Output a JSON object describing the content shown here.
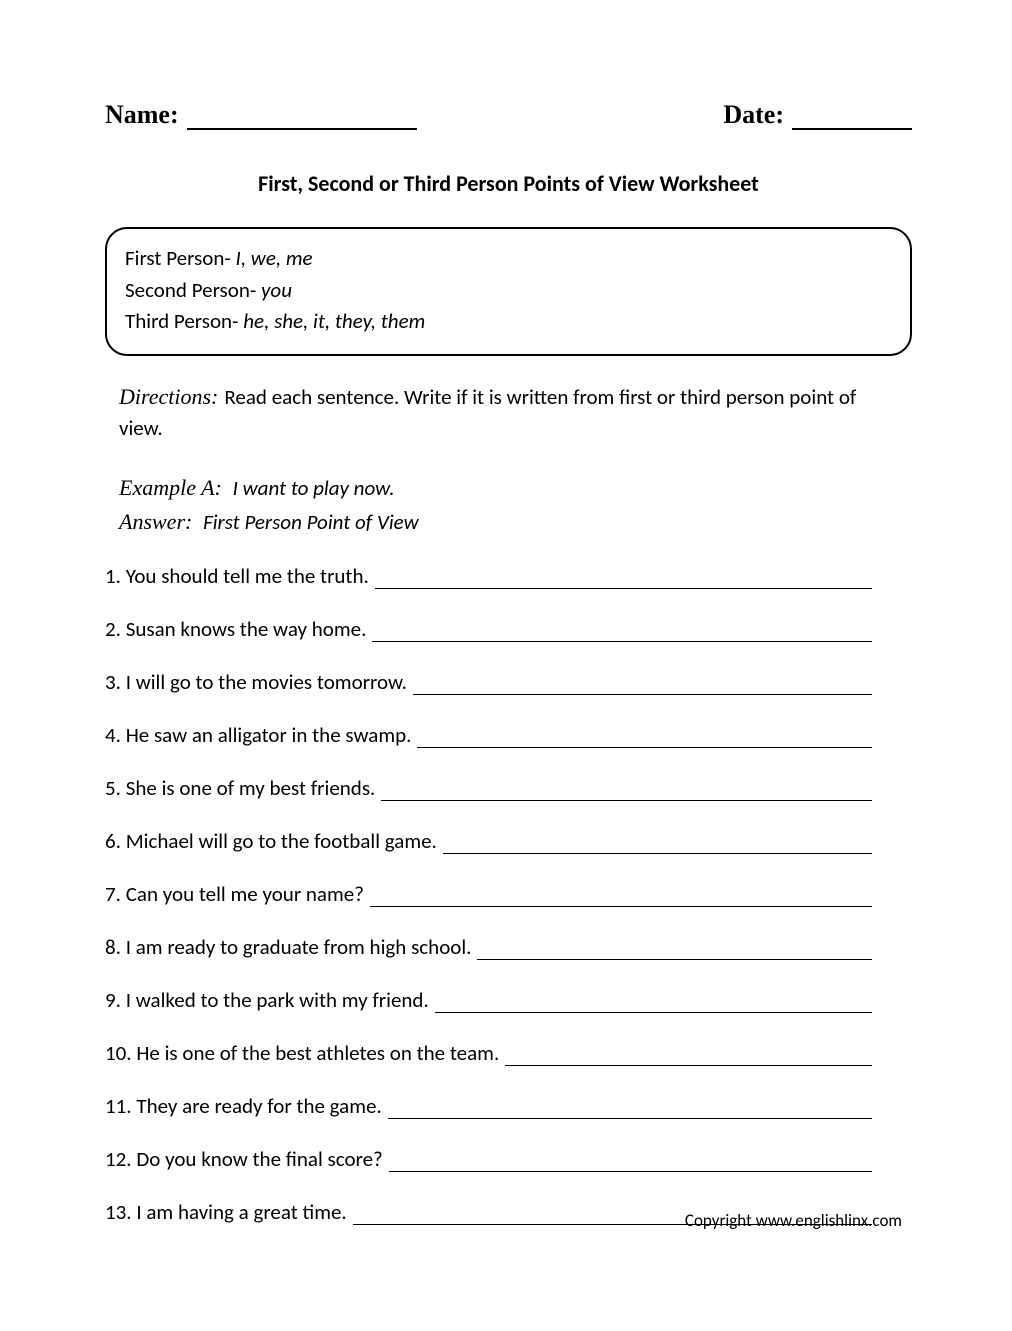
{
  "header": {
    "name_label": "Name:",
    "date_label": "Date:"
  },
  "title": "First, Second or Third Person Points of View Worksheet",
  "info_box": {
    "line1_label": "First Person- ",
    "line1_examples": "I, we, me",
    "line2_label": "Second Person- ",
    "line2_examples": "you",
    "line3_label": "Third Person- ",
    "line3_examples": "he, she, it, they, them"
  },
  "directions": {
    "label": "Directions:",
    "text": "Read each sentence. Write if it is written from first or third person point of view."
  },
  "example": {
    "label_a": "Example A:",
    "text_a": "I want to play now.",
    "label_ans": "Answer:",
    "text_ans": "First Person Point of View"
  },
  "questions": [
    "1. You should tell me the truth.",
    "2. Susan knows the way home.",
    "3. I will go to the movies tomorrow.",
    "4. He saw an alligator in the swamp.",
    "5. She is one of my best friends.",
    "6. Michael will go to the football game.",
    "7. Can you tell me your name?",
    "8. I am ready to graduate from high school.",
    "9. I walked to the park with my friend.",
    "10. He is one of the best athletes on the team.",
    "11. They are ready for the game.",
    "12. Do you know the final score?",
    "13. I am having a great time."
  ],
  "copyright": "Copyright www.englishlinx.com"
}
